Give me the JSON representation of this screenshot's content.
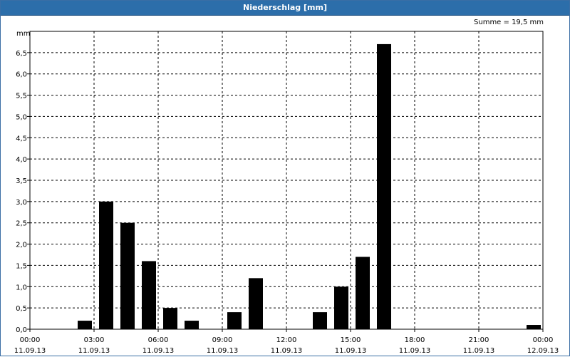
{
  "window": {
    "title": "Niederschlag [mm]",
    "summary": "Summe = 19,5 mm"
  },
  "chart_data": {
    "type": "bar",
    "title": "Niederschlag [mm]",
    "ylabel": "mm",
    "xlabel": "",
    "ylim": [
      0,
      7.0
    ],
    "grid": true,
    "grid_style": "dashed",
    "y_ticks": [
      "0,0",
      "0,5",
      "1,0",
      "1,5",
      "2,0",
      "2,5",
      "3,0",
      "3,5",
      "4,0",
      "4,5",
      "5,0",
      "5,5",
      "6,0",
      "6,5"
    ],
    "x_ticks": [
      {
        "time": "00:00",
        "date": "11.09.13"
      },
      {
        "time": "03:00",
        "date": "11.09.13"
      },
      {
        "time": "06:00",
        "date": "11.09.13"
      },
      {
        "time": "09:00",
        "date": "11.09.13"
      },
      {
        "time": "12:00",
        "date": "11.09.13"
      },
      {
        "time": "15:00",
        "date": "11.09.13"
      },
      {
        "time": "18:00",
        "date": "11.09.13"
      },
      {
        "time": "21:00",
        "date": "11.09.13"
      },
      {
        "time": "00:00",
        "date": "12.09.13"
      }
    ],
    "x_start": "2013-09-11 00:00",
    "x_end": "2013-09-12 00:00",
    "bar_interval_hours": 1,
    "bar_color": "#000000",
    "series": [
      {
        "values": [
          {
            "hour_end": 3,
            "value": 0.2
          },
          {
            "hour_end": 4,
            "value": 3.0
          },
          {
            "hour_end": 5,
            "value": 2.5
          },
          {
            "hour_end": 6,
            "value": 1.6
          },
          {
            "hour_end": 7,
            "value": 0.5
          },
          {
            "hour_end": 8,
            "value": 0.2
          },
          {
            "hour_end": 10,
            "value": 0.4
          },
          {
            "hour_end": 11,
            "value": 1.2
          },
          {
            "hour_end": 14,
            "value": 0.4
          },
          {
            "hour_end": 15,
            "value": 1.0
          },
          {
            "hour_end": 16,
            "value": 1.7
          },
          {
            "hour_end": 17,
            "value": 6.7
          },
          {
            "hour_end": 24,
            "value": 0.1
          }
        ]
      }
    ]
  }
}
